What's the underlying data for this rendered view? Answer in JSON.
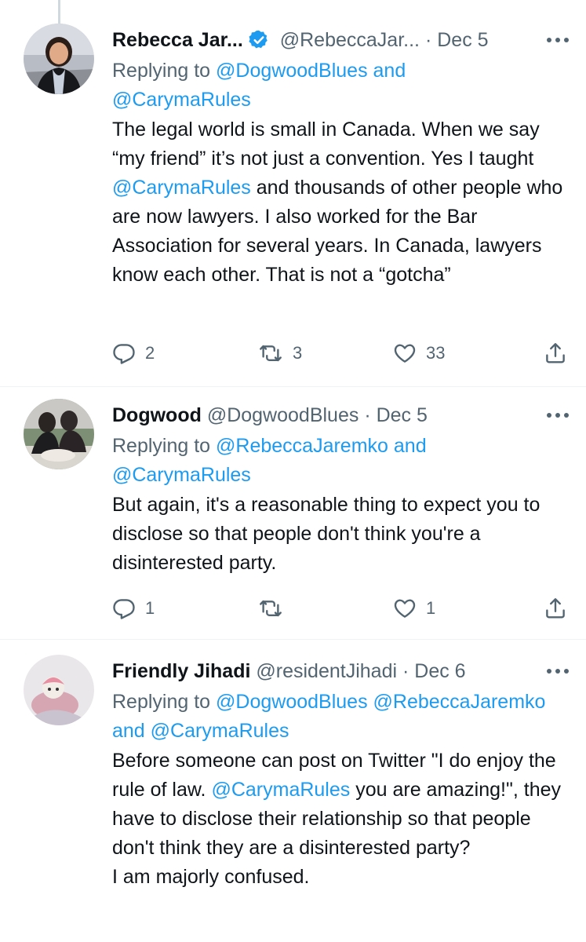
{
  "tweets": [
    {
      "name": "Rebecca Jar...",
      "verified": true,
      "handle": "@RebeccaJar...",
      "dot": "·",
      "date": "Dec 5",
      "reply_prefix": "Replying to",
      "reply_mentions": [
        "@DogwoodBlues",
        "and",
        "@CarymaRules"
      ],
      "body": [
        {
          "text": "The legal world is small in Canada. When we say “my friend” it’s not just a convention. Yes I taught "
        },
        {
          "text": "@CarymaRules",
          "mention": true
        },
        {
          "text": " and thousands of other people who are now lawyers. I also worked for the Bar Association for several years. In Canada, lawyers know each other. That is not a “gotcha”"
        }
      ],
      "actions": {
        "replies": "2",
        "retweets": "3",
        "likes": "33"
      }
    },
    {
      "name": "Dogwood",
      "verified": false,
      "handle": "@DogwoodBlues",
      "dot": "·",
      "date": "Dec 5",
      "reply_prefix": "Replying to",
      "reply_mentions": [
        "@RebeccaJaremko",
        "and",
        "@CarymaRules"
      ],
      "body": [
        {
          "text": "But again, it's a reasonable thing to expect you to disclose so that people don't think you're a disinterested party."
        }
      ],
      "actions": {
        "replies": "1",
        "retweets": "",
        "likes": "1"
      }
    },
    {
      "name": "Friendly Jihadi",
      "verified": false,
      "handle": "@residentJihadi",
      "dot": "·",
      "date": "Dec 6",
      "reply_prefix": "Replying to",
      "reply_mentions": [
        "@DogwoodBlues",
        "@RebeccaJaremko",
        "and",
        "@CarymaRules"
      ],
      "body": [
        {
          "text": "Before someone can post on Twitter \"I do enjoy the rule of law. "
        },
        {
          "text": "@CarymaRules",
          "mention": true
        },
        {
          "text": " you are amazing!\", they have to disclose their relationship so that people don't think they are a disinterested party?"
        },
        {
          "text": "\n"
        },
        {
          "text": "I am majorly confused."
        }
      ]
    }
  ],
  "colors": {
    "text": "#0f1419",
    "secondary": "#536471",
    "link": "#1d9bf0",
    "verified": "#1d9bf0",
    "divider": "#eff3f4"
  },
  "icons": {
    "reply": "reply-icon",
    "retweet": "retweet-icon",
    "like": "heart-icon",
    "share": "share-icon",
    "more": "more-icon",
    "verified": "verified-badge-icon"
  }
}
